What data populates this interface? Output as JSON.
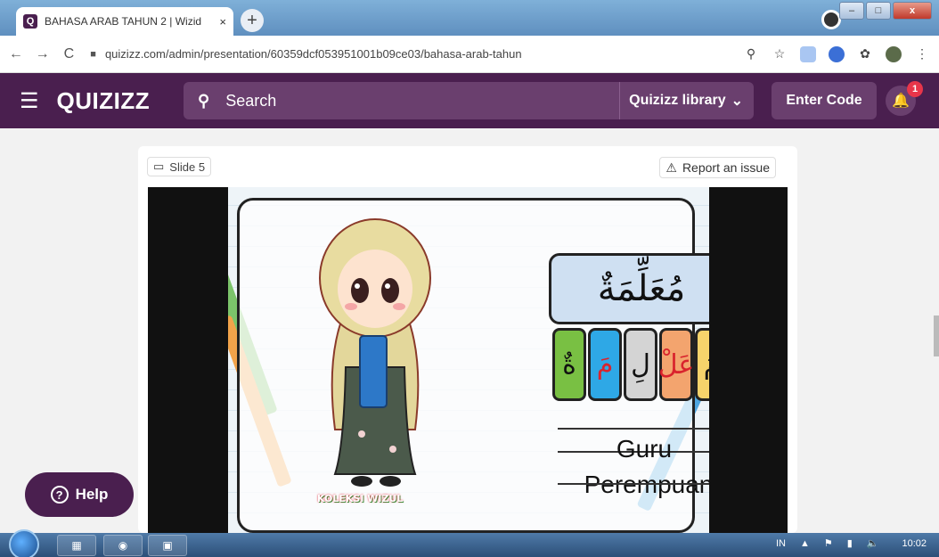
{
  "browser": {
    "tab_title": "BAHASA ARAB TAHUN 2 | Wizid",
    "tab_favicon": "Q",
    "tab_close": "×",
    "new_tab": "+",
    "url": "quizizz.com/admin/presentation/60359dcf053951001b09ce03/bahasa-arab-tahun",
    "nav_back": "←",
    "nav_forward": "→",
    "nav_reload": "C",
    "icons": [
      "zoom-icon",
      "star-icon",
      "page-icon",
      "extension-icon",
      "puzzle-icon",
      "profile-icon"
    ]
  },
  "header": {
    "logo": "QUIZIZZ",
    "search_placeholder": "Search",
    "library_label": "Quizizz library",
    "enter_code": "Enter Code",
    "notification_count": "1"
  },
  "slide": {
    "label": "Slide 5",
    "report_label": "Report an issue",
    "arabic_word": "مُعَلِّمَةٌ",
    "syllables": [
      {
        "text": "مُ",
        "color": "#f6d36b",
        "red": false
      },
      {
        "text": "عَلْ",
        "color": "#f3a46e",
        "red": true
      },
      {
        "text": "لِ",
        "color": "#d4d4d4",
        "red": false
      },
      {
        "text": "مَ",
        "color": "#2ea8e6",
        "red": true
      },
      {
        "text": "ةٌ",
        "color": "#79c043",
        "red": false
      }
    ],
    "meaning_line1": "Guru",
    "meaning_line2": "Perempuan",
    "brand_text": "KOLEKSI WIZUL"
  },
  "help": {
    "label": "Help"
  },
  "taskbar": {
    "tray_lang": "IN",
    "clock": "10:02"
  }
}
